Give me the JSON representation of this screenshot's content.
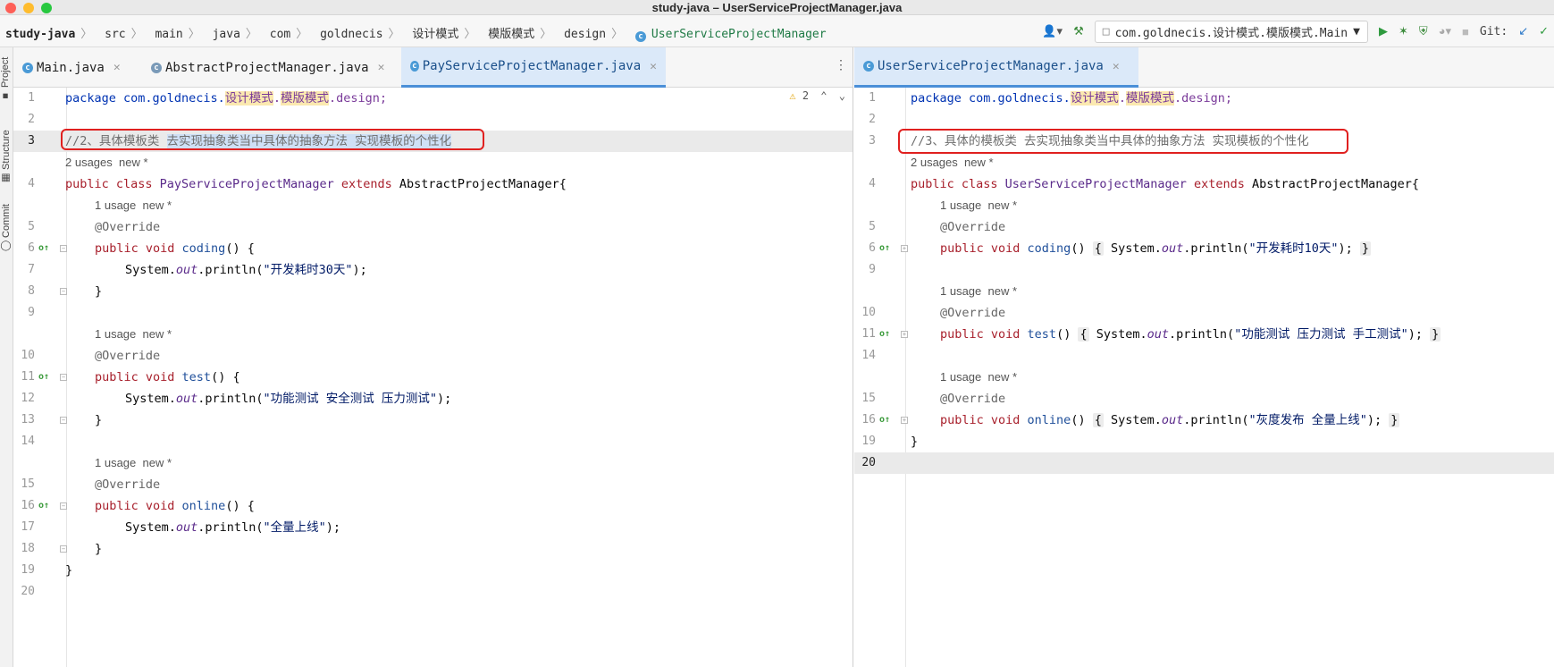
{
  "window": {
    "title": "study-java – UserServiceProjectManager.java"
  },
  "breadcrumbs": [
    "study-java",
    "src",
    "main",
    "java",
    "com",
    "goldnecis",
    "设计模式",
    "模版模式",
    "design",
    "UserServiceProjectManager"
  ],
  "toolbar": {
    "run_config": "com.goldnecis.设计模式.模版模式.Main",
    "git_label": "Git:"
  },
  "sidebar": {
    "project": "Project",
    "structure": "Structure",
    "commit": "Commit"
  },
  "left_tabs": [
    {
      "label": "Main.java",
      "active": false
    },
    {
      "label": "AbstractProjectManager.java",
      "active": false
    },
    {
      "label": "PayServiceProjectManager.java",
      "active": true
    }
  ],
  "right_tabs": [
    {
      "label": "UserServiceProjectManager.java",
      "active": true
    }
  ],
  "left_editor": {
    "warning_count": "2",
    "line_numbers": [
      "1",
      "2",
      "3",
      "",
      "4",
      "",
      "5",
      "6",
      "7",
      "8",
      "9",
      "",
      "10",
      "11",
      "12",
      "13",
      "14",
      "",
      "15",
      "16",
      "17",
      "18",
      "19",
      "20"
    ],
    "package_prefix": "package com.goldnecis.",
    "package_seg1": "设计模式",
    "package_seg2": "模版模式",
    "package_suffix": ".design;",
    "comment_part1": "//2、具体模板类 ",
    "comment_part2": "去实现抽象类当中具体的抽象方法 实现模板的个性化",
    "usages_2": "2 usages  new *",
    "class_kw": "public class ",
    "class_name": "PayServiceProjectManager",
    "extends_kw": " extends ",
    "parent_class": "AbstractProjectManager{",
    "usage_1": "1 usage  new *",
    "override": "@Override",
    "method_kw": "public void ",
    "m1": "coding",
    "m2": "test",
    "m3": "online",
    "paren_open": "() {",
    "sys": "System.",
    "out": "out",
    "println": ".println(",
    "s1": "\"开发耗时30天\"",
    "s2": "\"功能测试 安全测试 压力测试\"",
    "s3": "\"全量上线\"",
    "end_stmt": ");",
    "close_brace": "}"
  },
  "right_editor": {
    "line_numbers": [
      "1",
      "2",
      "3",
      "",
      "4",
      "",
      "5",
      "6",
      "9",
      "",
      "10",
      "11",
      "14",
      "",
      "15",
      "16",
      "19",
      "20"
    ],
    "package_prefix": "package com.goldnecis.",
    "package_seg1": "设计模式",
    "package_seg2": "模版模式",
    "package_suffix": ".design;",
    "comment": "//3、具体的模板类 去实现抽象类当中具体的抽象方法 实现模板的个性化",
    "usages_2": "2 usages  new *",
    "class_kw": "public class ",
    "class_name": "UserServiceProjectManager",
    "extends_kw": " extends ",
    "parent_class": "AbstractProjectManager{",
    "usage_1": "1 usage  new *",
    "override": "@Override",
    "method_kw": "public void ",
    "m1": "coding",
    "m2": "test",
    "m3": "online",
    "paren": "()",
    "open": "{",
    "sys": " System.",
    "out": "out",
    "println": ".println(",
    "s1": "\"开发耗时10天\"",
    "s2": "\"功能测试 压力测试 手工测试\"",
    "s3": "\"灰度发布 全量上线\"",
    "end_stmt": ");",
    "close": "}",
    "close_brace": "}"
  }
}
